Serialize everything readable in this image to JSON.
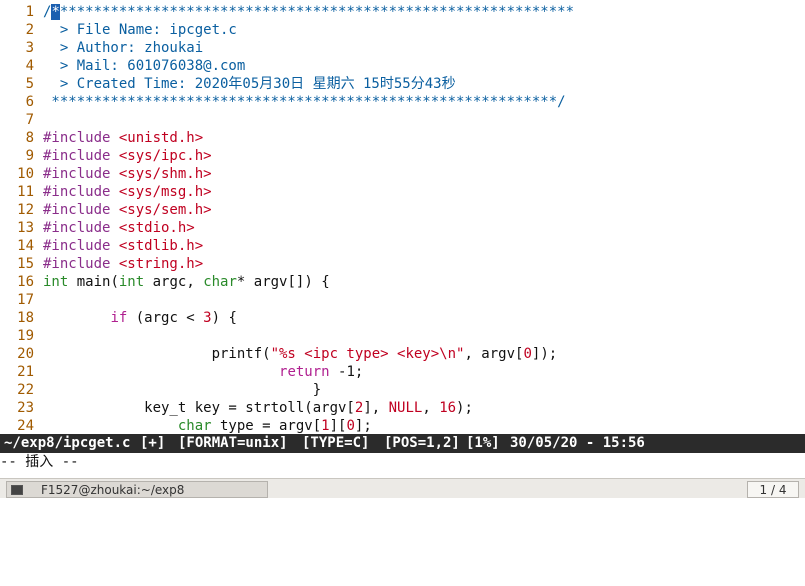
{
  "editor": {
    "lines": [
      {
        "num": "1",
        "segments": [
          {
            "text": "/",
            "cls": "c-comment"
          },
          {
            "text": "*",
            "cls": "cursor"
          },
          {
            "text": "*************************************************************",
            "cls": "c-comment"
          }
        ]
      },
      {
        "num": "2",
        "segments": [
          {
            "text": "  > File Name: ipcget.c",
            "cls": "c-comment"
          }
        ]
      },
      {
        "num": "3",
        "segments": [
          {
            "text": "  > Author: zhoukai",
            "cls": "c-comment"
          }
        ]
      },
      {
        "num": "4",
        "segments": [
          {
            "text": "  > Mail: 601076038@.com",
            "cls": "c-comment"
          }
        ]
      },
      {
        "num": "5",
        "segments": [
          {
            "text": "  > Created Time: 2020年05月30日 星期六 15时55分43秒",
            "cls": "c-comment"
          }
        ]
      },
      {
        "num": "6",
        "segments": [
          {
            "text": " ************************************************************/",
            "cls": "c-comment"
          }
        ]
      },
      {
        "num": "7",
        "segments": []
      },
      {
        "num": "8",
        "segments": [
          {
            "text": "#include ",
            "cls": "c-pre"
          },
          {
            "text": "<unistd.h>",
            "cls": "c-str"
          }
        ]
      },
      {
        "num": "9",
        "segments": [
          {
            "text": "#include ",
            "cls": "c-pre"
          },
          {
            "text": "<sys/ipc.h>",
            "cls": "c-str"
          }
        ]
      },
      {
        "num": "10",
        "segments": [
          {
            "text": "#include ",
            "cls": "c-pre"
          },
          {
            "text": "<sys/shm.h>",
            "cls": "c-str"
          }
        ]
      },
      {
        "num": "11",
        "segments": [
          {
            "text": "#include ",
            "cls": "c-pre"
          },
          {
            "text": "<sys/msg.h>",
            "cls": "c-str"
          }
        ]
      },
      {
        "num": "12",
        "segments": [
          {
            "text": "#include ",
            "cls": "c-pre"
          },
          {
            "text": "<sys/sem.h>",
            "cls": "c-str"
          }
        ]
      },
      {
        "num": "13",
        "segments": [
          {
            "text": "#include ",
            "cls": "c-pre"
          },
          {
            "text": "<stdio.h>",
            "cls": "c-str"
          }
        ]
      },
      {
        "num": "14",
        "segments": [
          {
            "text": "#include ",
            "cls": "c-pre"
          },
          {
            "text": "<stdlib.h>",
            "cls": "c-str"
          }
        ]
      },
      {
        "num": "15",
        "segments": [
          {
            "text": "#include ",
            "cls": "c-pre"
          },
          {
            "text": "<string.h>",
            "cls": "c-str"
          }
        ]
      },
      {
        "num": "16",
        "segments": [
          {
            "text": "int",
            "cls": "c-type"
          },
          {
            "text": " main(",
            "cls": "c-plain"
          },
          {
            "text": "int",
            "cls": "c-type"
          },
          {
            "text": " argc, ",
            "cls": "c-plain"
          },
          {
            "text": "char",
            "cls": "c-type"
          },
          {
            "text": "* argv[]) {",
            "cls": "c-plain"
          }
        ]
      },
      {
        "num": "17",
        "segments": []
      },
      {
        "num": "18",
        "segments": [
          {
            "text": "        ",
            "cls": "c-plain"
          },
          {
            "text": "if",
            "cls": "c-kw"
          },
          {
            "text": " (argc < ",
            "cls": "c-plain"
          },
          {
            "text": "3",
            "cls": "c-num"
          },
          {
            "text": ") {",
            "cls": "c-plain"
          }
        ]
      },
      {
        "num": "19",
        "segments": []
      },
      {
        "num": "20",
        "segments": [
          {
            "text": "                    printf(",
            "cls": "c-plain"
          },
          {
            "text": "\"%s <ipc type> <key>\\n\"",
            "cls": "c-str"
          },
          {
            "text": ", argv[",
            "cls": "c-plain"
          },
          {
            "text": "0",
            "cls": "c-num"
          },
          {
            "text": "]);",
            "cls": "c-plain"
          }
        ]
      },
      {
        "num": "21",
        "segments": [
          {
            "text": "                            ",
            "cls": "c-plain"
          },
          {
            "text": "return",
            "cls": "c-kw"
          },
          {
            "text": " -1;",
            "cls": "c-plain"
          }
        ]
      },
      {
        "num": "22",
        "segments": [
          {
            "text": "                                }",
            "cls": "c-plain"
          }
        ]
      },
      {
        "num": "23",
        "segments": [
          {
            "text": "            key_t key = strtoll(argv[",
            "cls": "c-plain"
          },
          {
            "text": "2",
            "cls": "c-num"
          },
          {
            "text": "], ",
            "cls": "c-plain"
          },
          {
            "text": "NULL",
            "cls": "c-num"
          },
          {
            "text": ", ",
            "cls": "c-plain"
          },
          {
            "text": "16",
            "cls": "c-num"
          },
          {
            "text": ");",
            "cls": "c-plain"
          }
        ]
      },
      {
        "num": "24",
        "segments": [
          {
            "text": "                ",
            "cls": "c-plain"
          },
          {
            "text": "char",
            "cls": "c-type"
          },
          {
            "text": " type = argv[",
            "cls": "c-plain"
          },
          {
            "text": "1",
            "cls": "c-num"
          },
          {
            "text": "][",
            "cls": "c-plain"
          },
          {
            "text": "0",
            "cls": "c-num"
          },
          {
            "text": "];",
            "cls": "c-plain"
          }
        ]
      }
    ]
  },
  "status": {
    "file": "~/exp8/ipcget.c",
    "flag": "[+]",
    "format": "[FORMAT=unix]",
    "type": "[TYPE=C]",
    "pos": "[POS=1,2]",
    "percent": "[1%]",
    "datetime": "30/05/20 - 15:56"
  },
  "mode": "-- 插入 --",
  "taskbar": {
    "window_label": "F1527@zhoukai:~/exp8",
    "workspace": "1 / 4"
  }
}
